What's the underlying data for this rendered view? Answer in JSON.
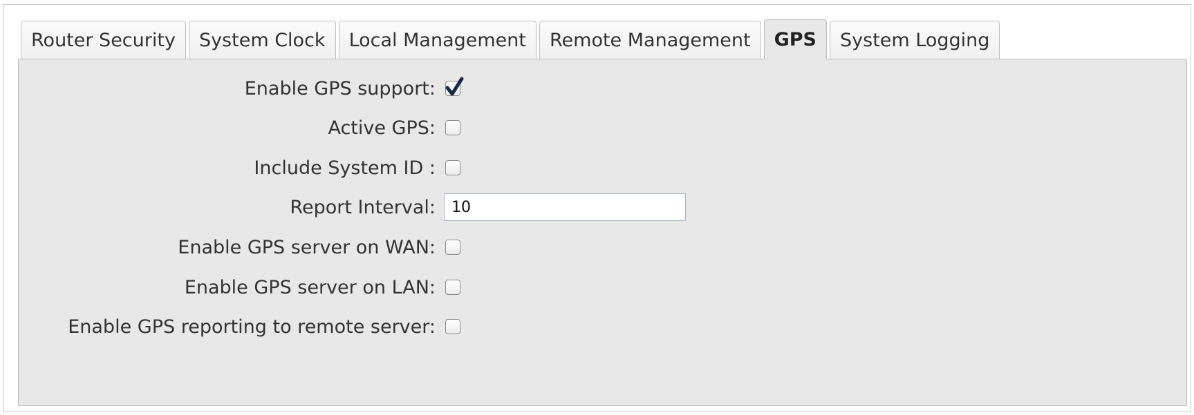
{
  "tabs": [
    {
      "label": "Router Security",
      "active": false
    },
    {
      "label": "System Clock",
      "active": false
    },
    {
      "label": "Local Management",
      "active": false
    },
    {
      "label": "Remote Management",
      "active": false
    },
    {
      "label": "GPS",
      "active": true
    },
    {
      "label": "System Logging",
      "active": false
    }
  ],
  "gps": {
    "enable_gps_support": {
      "label": "Enable GPS support:",
      "checked": true
    },
    "active_gps": {
      "label": "Active GPS:",
      "checked": false
    },
    "include_system_id": {
      "label": "Include System ID :",
      "checked": false
    },
    "report_interval": {
      "label": "Report Interval:",
      "value": "10"
    },
    "gps_server_wan": {
      "label": "Enable GPS server on WAN:",
      "checked": false
    },
    "gps_server_lan": {
      "label": "Enable GPS server on LAN:",
      "checked": false
    },
    "gps_remote_reporting": {
      "label": "Enable GPS reporting to remote server:",
      "checked": false
    }
  },
  "colors": {
    "panel_bg": "#e8e8e8",
    "checkmark": "#1a2a44"
  },
  "icons": {
    "checkbox_checked": "checkmark-icon"
  }
}
